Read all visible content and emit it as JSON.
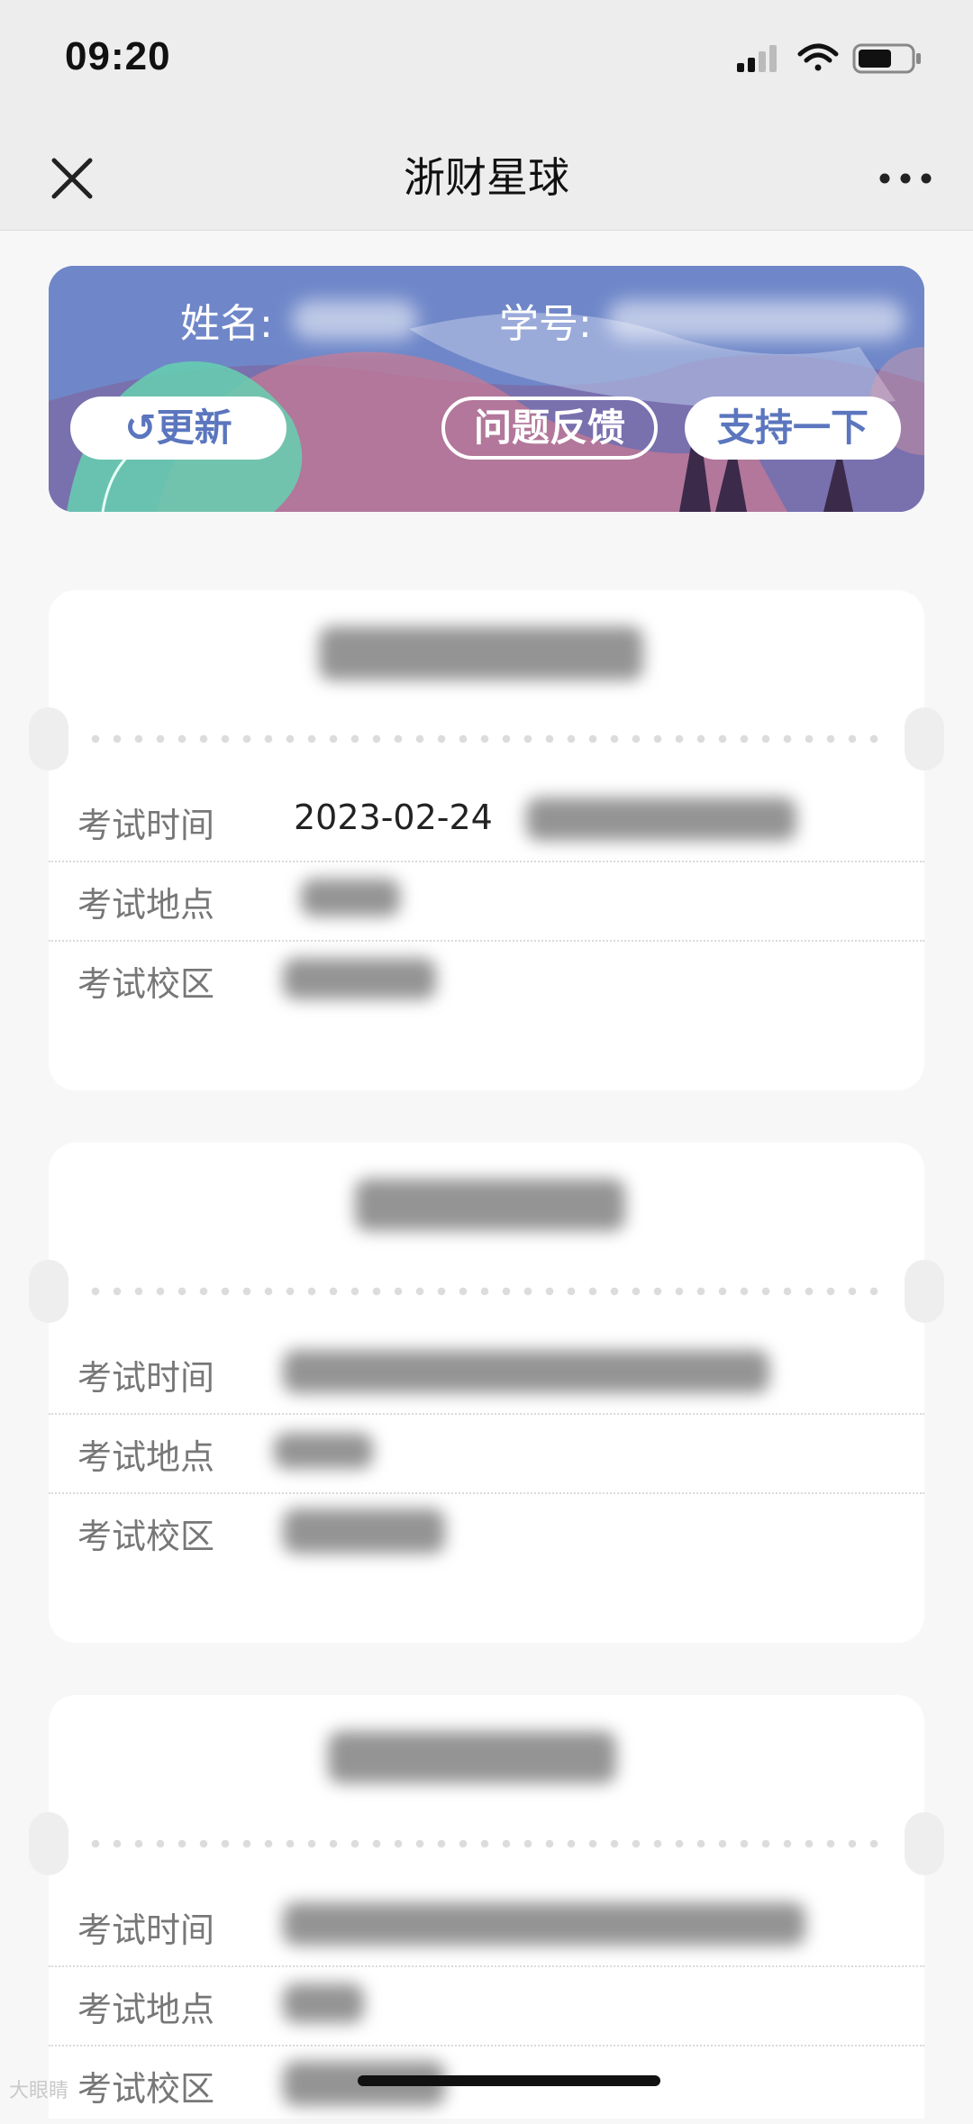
{
  "status_bar": {
    "time": "09:20"
  },
  "nav": {
    "title": "浙财星球"
  },
  "banner": {
    "name_label": "姓名:",
    "id_label": "学号:",
    "refresh_label": "↺更新",
    "feedback_label": "问题反馈",
    "support_label": "支持一下"
  },
  "exams": [
    {
      "time_label": "考试时间",
      "time_value": "2023-02-24",
      "place_label": "考试地点",
      "campus_label": "考试校区"
    },
    {
      "time_label": "考试时间",
      "time_value": "",
      "place_label": "考试地点",
      "campus_label": "考试校区"
    },
    {
      "time_label": "考试时间",
      "time_value": "",
      "place_label": "考试地点",
      "campus_label": "考试校区"
    }
  ],
  "watermark": "大眼睛"
}
